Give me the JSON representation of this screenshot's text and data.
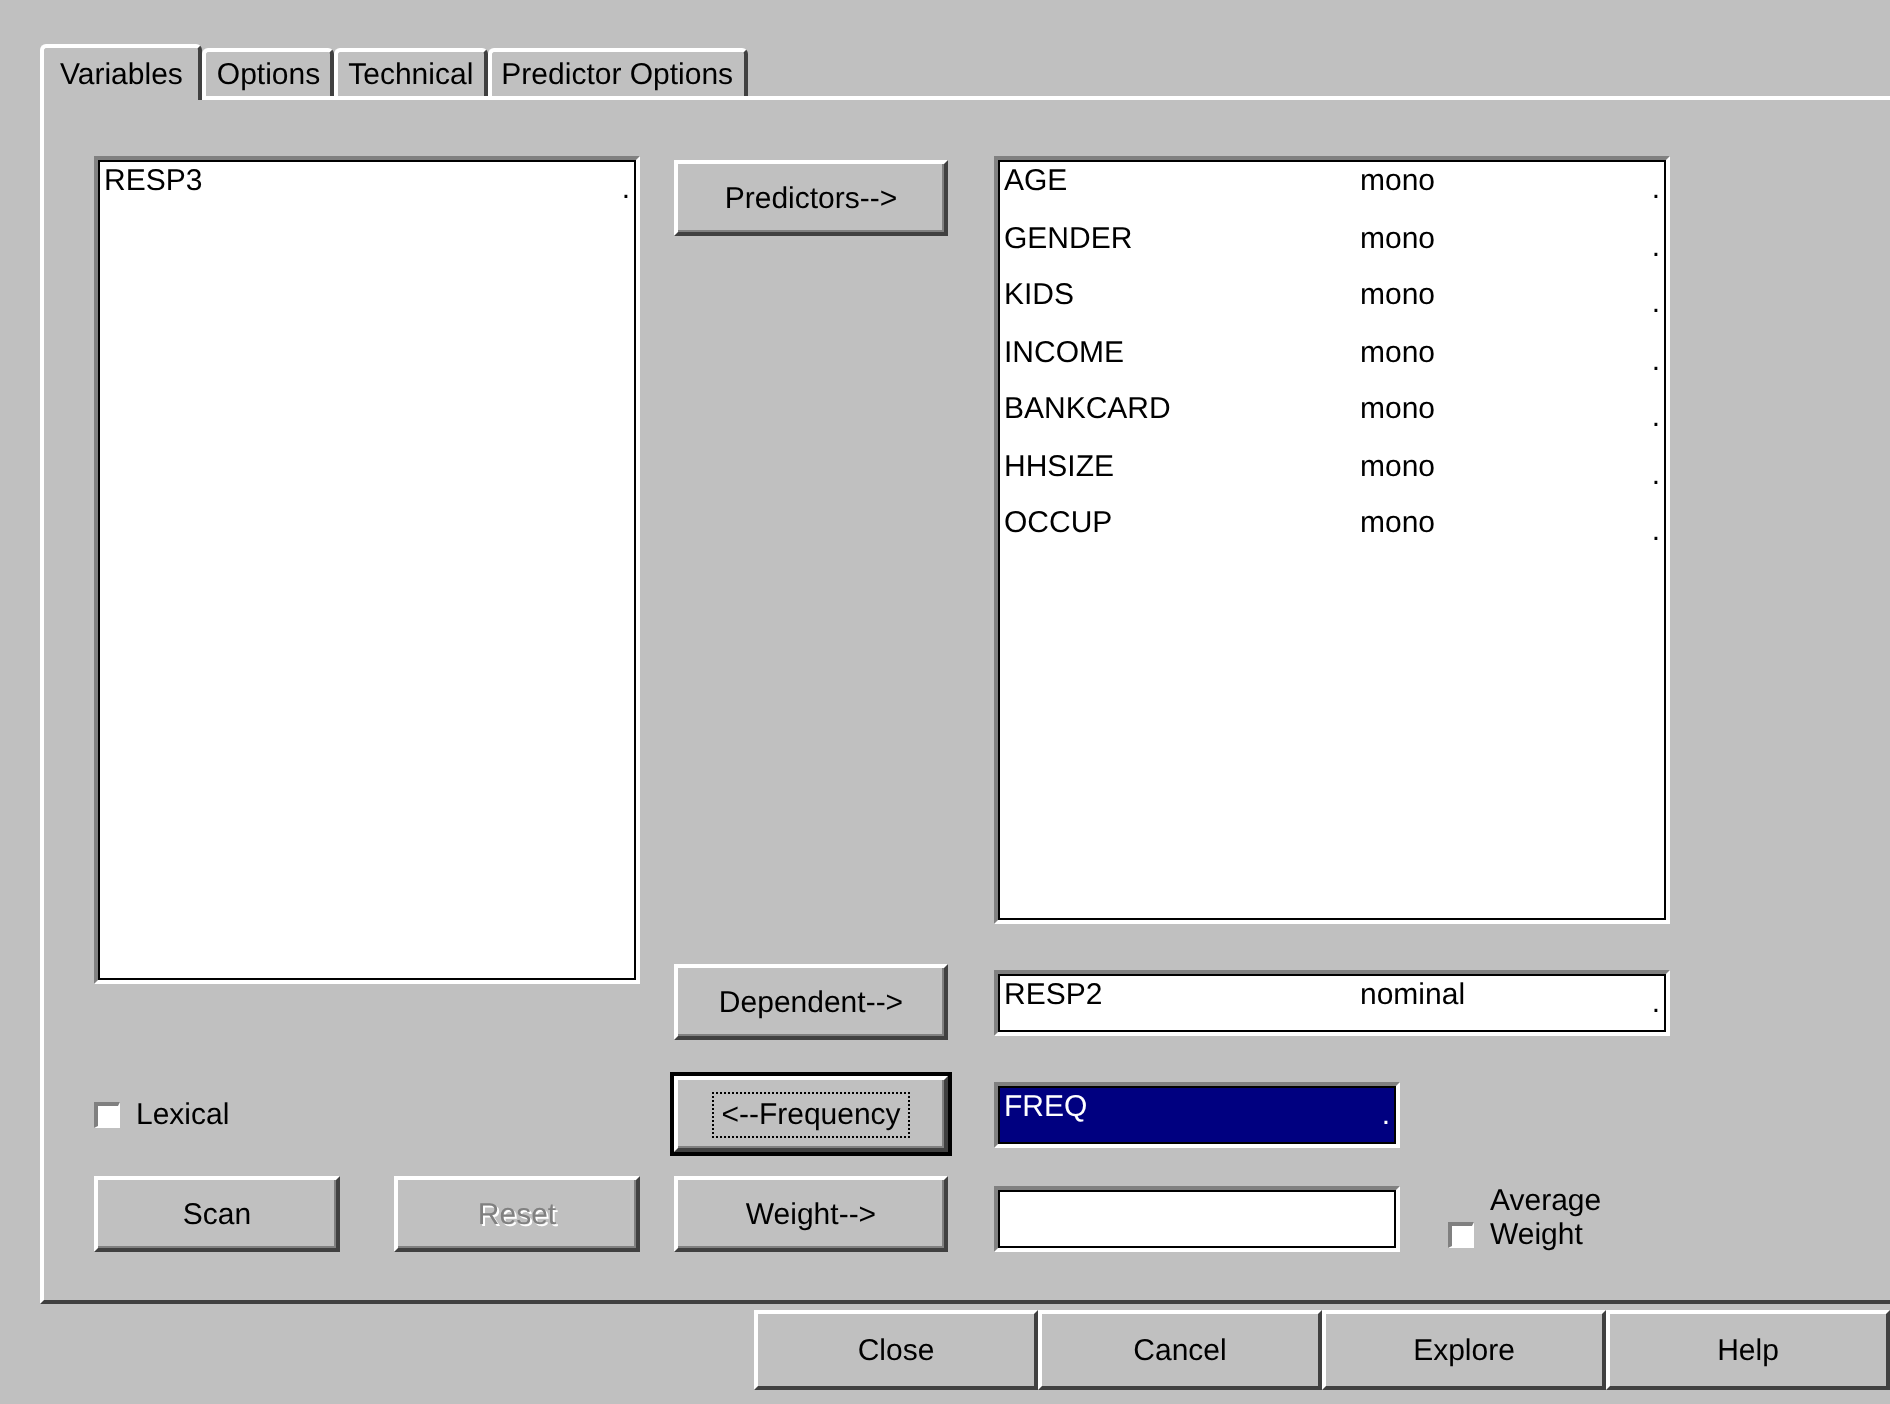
{
  "tabs": [
    {
      "label": "Variables",
      "selected": true
    },
    {
      "label": "Options",
      "selected": false
    },
    {
      "label": "Technical",
      "selected": false
    },
    {
      "label": "Predictor Options",
      "selected": false
    }
  ],
  "variables_list": {
    "items": [
      {
        "name": "RESP3",
        "column_3": "."
      }
    ]
  },
  "buttons": {
    "predictors": {
      "label": "Predictors-->",
      "focused": false
    },
    "dependent": {
      "label": "Dependent-->",
      "focused": false
    },
    "frequency": {
      "label": "<--Frequency",
      "focused": true
    },
    "weight": {
      "label": "Weight-->",
      "focused": false
    },
    "scan": {
      "label": "Scan",
      "disabled": false
    },
    "reset": {
      "label": "Reset",
      "disabled": true
    }
  },
  "predictors_list": {
    "items": [
      {
        "name": "AGE",
        "type": "mono",
        "column_3": "."
      },
      {
        "name": "GENDER",
        "type": "mono",
        "column_3": "."
      },
      {
        "name": "KIDS",
        "type": "mono",
        "column_3": "."
      },
      {
        "name": "INCOME",
        "type": "mono",
        "column_3": "."
      },
      {
        "name": "BANKCARD",
        "type": "mono",
        "column_3": "."
      },
      {
        "name": "HHSIZE",
        "type": "mono",
        "column_3": "."
      },
      {
        "name": "OCCUP",
        "type": "mono",
        "column_3": "."
      }
    ]
  },
  "dependent_field": {
    "name": "RESP2",
    "type": "nominal",
    "column_3": "."
  },
  "frequency_field": {
    "name": "FREQ",
    "column_3": ".",
    "selected": true
  },
  "weight_field": {
    "kind": "empty"
  },
  "lexical": {
    "label": "Lexical",
    "checked": false
  },
  "average_weight": {
    "label": "Average Weight",
    "checked": false
  },
  "footer_buttons": [
    "Close",
    "Cancel",
    "Explore",
    "Help"
  ]
}
